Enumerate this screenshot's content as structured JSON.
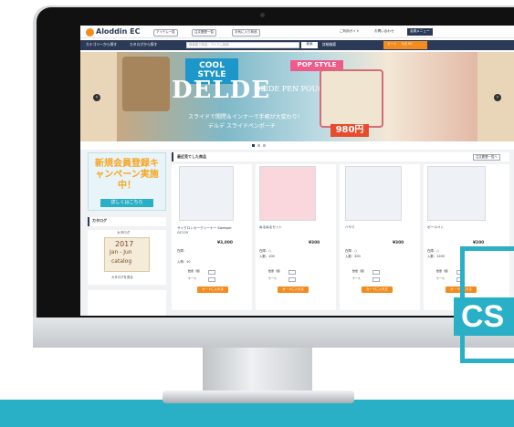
{
  "header": {
    "logo_text": "Aloddin EC",
    "top_links": [
      "アイテム一覧",
      "注文履歴一覧",
      "お気に入り商品"
    ],
    "user_links": [
      "ご利用ガイド",
      "お問い合わせ",
      "会員メニュー"
    ]
  },
  "nav": {
    "category_browse": "カテゴリーから探す",
    "catalog_browse": "カタログから探す",
    "search_placeholder": "検索語で商品・アイテム検索",
    "search_button": "検索",
    "detail_search": "詳細検索",
    "cart_label": "カート",
    "cart_amount": "0点 ¥0"
  },
  "banner": {
    "tagline_top": "COOL STYLE",
    "brand": "DELDE",
    "subtitle": "SLIDE PEN POUCH",
    "pop_tag": "POP STYLE",
    "caption_line1": "スライドで開閉＆インナーで手帳が大変わり！",
    "caption_line2": "デルデ スライドペンポーチ",
    "price": "980円"
  },
  "sidebar": {
    "promo_title": "新規会員登録キャンペーン実施中！",
    "promo_button": "詳しくはこちら",
    "catalog_heading": "カタログ",
    "catalog_label": "カタログ",
    "catalog_year": "2017",
    "catalog_period": "Jan - Jun",
    "catalog_word": "catalog",
    "catalog_link": "カタログを見る"
  },
  "main": {
    "section_title": "最近見てした商品",
    "view_all": "注文履歴一覧へ",
    "products": [
      {
        "name": "サイクロンカークリーナー Sweeper GC12V",
        "price": "¥3,000",
        "stock": "在庫：",
        "note": "入荷：10"
      },
      {
        "name": "ぬるぬるセット",
        "price": "¥300",
        "stock": "在庫：○",
        "note": "入数：100"
      },
      {
        "name": "ハサミ",
        "price": "¥300",
        "stock": "在庫：○",
        "note": "入数：300"
      },
      {
        "name": "ボールペン",
        "price": "¥200",
        "stock": "在庫：○",
        "note": "入数：1200"
      }
    ],
    "qty_label_1": "数量（個）",
    "qty_label_2": "ケース",
    "add_to_cart": "カートに入れる"
  },
  "badge": {
    "text": "CS"
  },
  "colors": {
    "accent": "#2ab0c6",
    "nav": "#2b3b57",
    "cta": "#f28c1e"
  }
}
